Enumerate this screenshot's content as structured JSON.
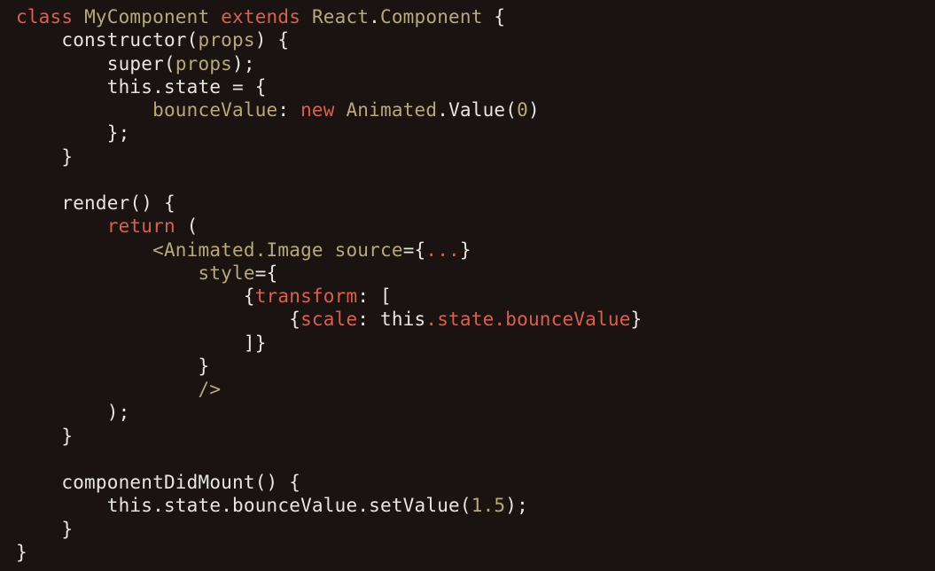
{
  "code": {
    "l1": {
      "kw_class": "class",
      "id_MyComponent": "MyComponent",
      "kw_extends": "extends",
      "id_React": "React",
      "dot": ".",
      "id_Component": "Component",
      "lbrace": " {"
    },
    "l2": {
      "indent": "    ",
      "fn_constructor": "constructor",
      "paren_open": "(",
      "id_props": "props",
      "paren_close": ")",
      "lbrace": " {"
    },
    "l3": {
      "indent": "        ",
      "fn_super": "super",
      "paren_open": "(",
      "id_props": "props",
      "close": ");"
    },
    "l4": {
      "indent": "        ",
      "this": "this",
      "dot": ".",
      "state": "state",
      "eq": " = ",
      "lbrace": "{"
    },
    "l5": {
      "indent": "            ",
      "key": "bounceValue",
      "colon": ":",
      "sp": " ",
      "kw_new": "new",
      "sp2": " ",
      "id_Animated": "Animated",
      "dot": ".",
      "fn_Value": "Value",
      "paren_open": "(",
      "num": "0",
      "paren_close": ")"
    },
    "l6": {
      "indent": "        ",
      "rbrace": "};"
    },
    "l7": {
      "indent": "    ",
      "rbrace": "}"
    },
    "l8": {
      "blank": ""
    },
    "l9": {
      "indent": "    ",
      "fn_render": "render",
      "parens": "()",
      "lbrace": " {"
    },
    "l10": {
      "indent": "        ",
      "kw_return": "return",
      "paren_open": " ("
    },
    "l11": {
      "indent": "            ",
      "lt": "<",
      "tag": "Animated.Image",
      "sp": " ",
      "attr_source": "source",
      "eq": "=",
      "lbrace": "{",
      "ellip": "...",
      "rbrace": "}"
    },
    "l12": {
      "indent": "                ",
      "attr_style": "style",
      "eq": "=",
      "lbrace": "{"
    },
    "l13": {
      "indent": "                    ",
      "lbrace": "{",
      "key_transform": "transform",
      "colon": ":",
      "bracket_open": " ["
    },
    "l14": {
      "indent": "                        ",
      "lbrace": "{",
      "key_scale": "scale",
      "colon": ":",
      "sp": " ",
      "this": "this",
      "dot1": ".",
      "state": "state",
      "dot2": ".",
      "bounceValue": "bounceValue",
      "rbrace": "}"
    },
    "l15": {
      "indent": "                    ",
      "bracket_close": "]",
      "rbrace": "}"
    },
    "l16": {
      "indent": "                ",
      "rbrace": "}"
    },
    "l17": {
      "indent": "                ",
      "selfclose": "/>"
    },
    "l18": {
      "indent": "        ",
      "paren_close": ");"
    },
    "l19": {
      "indent": "    ",
      "rbrace": "}"
    },
    "l20": {
      "blank": ""
    },
    "l21": {
      "indent": "    ",
      "fn": "componentDidMount",
      "parens": "()",
      "lbrace": " {"
    },
    "l22": {
      "indent": "        ",
      "this": "this",
      "dot1": ".",
      "state": "state",
      "dot2": ".",
      "bounceValue": "bounceValue",
      "dot3": ".",
      "fn_setValue": "setValue",
      "paren_open": "(",
      "num": "1.5",
      "close": ");"
    },
    "l23": {
      "indent": "    ",
      "rbrace": "}"
    },
    "l24": {
      "rbrace": "}"
    }
  }
}
